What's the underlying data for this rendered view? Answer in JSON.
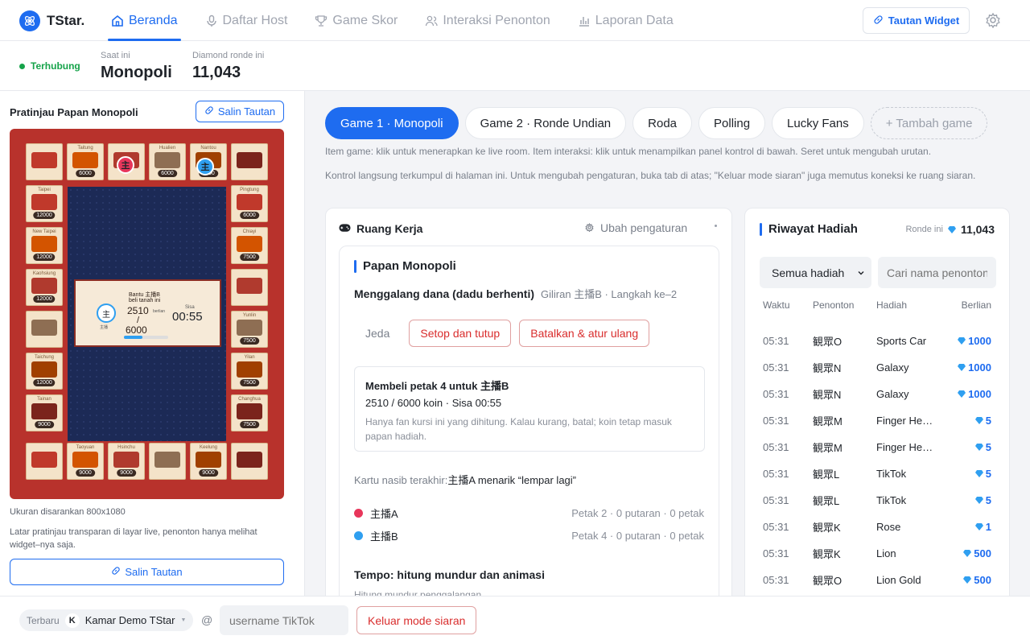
{
  "app": {
    "name": "TStar."
  },
  "nav": [
    {
      "label": "Beranda",
      "icon": "home-icon",
      "active": true
    },
    {
      "label": "Daftar Host",
      "icon": "microphone-icon",
      "active": false
    },
    {
      "label": "Game Skor",
      "icon": "trophy-icon",
      "active": false
    },
    {
      "label": "Interaksi Penonton",
      "icon": "users-icon",
      "active": false
    },
    {
      "label": "Laporan Data",
      "icon": "bar-chart-icon",
      "active": false
    }
  ],
  "header": {
    "widget_button": "Tautan Widget",
    "settings_icon": "gear-icon"
  },
  "status": {
    "connection": "Terhubung",
    "current_label": "Saat ini",
    "current_value": "Monopoli",
    "diamond_label": "Diamond ronde ini",
    "diamond_value": "11,043"
  },
  "preview": {
    "title": "Pratinjau Papan Monopoli",
    "copy_link": "Salin Tautan",
    "board": {
      "top_tiles": [
        {
          "name": "",
          "price": ""
        },
        {
          "name": "Taitung",
          "price": "6000"
        },
        {
          "name": "",
          "price": ""
        },
        {
          "name": "Hualien",
          "price": "6000"
        },
        {
          "name": "Nantou",
          "price": "6000"
        },
        {
          "name": "",
          "price": ""
        }
      ],
      "left_tiles": [
        {
          "name": "Taipei",
          "price": "12000"
        },
        {
          "name": "New Taipei",
          "price": "12000"
        },
        {
          "name": "Kaohsiung",
          "price": "12000"
        },
        {
          "name": "",
          "price": ""
        },
        {
          "name": "Taichung",
          "price": "12000"
        },
        {
          "name": "Tainan",
          "price": "9000"
        }
      ],
      "right_tiles": [
        {
          "name": "Pingtung",
          "price": "6000"
        },
        {
          "name": "Chiayi",
          "price": "7500"
        },
        {
          "name": "",
          "price": ""
        },
        {
          "name": "Yunlin",
          "price": "7500"
        },
        {
          "name": "Yilan",
          "price": "7500"
        },
        {
          "name": "Changhua",
          "price": "7500"
        }
      ],
      "bottom_tiles": [
        {
          "name": "",
          "price": ""
        },
        {
          "name": "Taoyuan",
          "price": "9000"
        },
        {
          "name": "Hsinchu",
          "price": "9000"
        },
        {
          "name": "",
          "price": ""
        },
        {
          "name": "Keelung",
          "price": "9000"
        },
        {
          "name": "",
          "price": ""
        }
      ],
      "tokens": [
        "主",
        "主"
      ],
      "card": {
        "line1": "Bantu 主播B",
        "line2": "beli tanah ini",
        "amount": "2510",
        "amount_unit": "berlian",
        "slash": "/",
        "target": "6000",
        "remaining_label": "Sisa",
        "timer": "00:55",
        "host_tag": "主播",
        "progress_fraction": 0.42
      }
    },
    "size_hint": "Ukuran disarankan 800x1080",
    "transparency_hint": "Latar pratinjau transparan di layar live, penonton hanya melihat widget–nya saja.",
    "copy_link_bottom": "Salin Tautan"
  },
  "games": {
    "tabs": [
      {
        "label": "Game 1 · Monopoli",
        "active": true
      },
      {
        "label": "Game 2 · Ronde Undian",
        "active": false
      },
      {
        "label": "Roda",
        "active": false
      },
      {
        "label": "Polling",
        "active": false
      },
      {
        "label": "Lucky Fans",
        "active": false
      }
    ],
    "add_label": "+ Tambah game",
    "note1": "Item game: klik untuk menerapkan ke live room. Item interaksi: klik untuk menampilkan panel kontrol di bawah. Seret untuk mengubah urutan.",
    "note2": "Kontrol langsung terkumpul di halaman ini. Untuk mengubah pengaturan, buka tab di atas; \"Keluar mode siaran\" juga memutus koneksi ke ruang siaran."
  },
  "workspace": {
    "title": "Ruang Kerja",
    "settings_link": "Ubah pengaturan",
    "board_title": "Papan Monopoli",
    "phase": "Menggalang dana (dadu berhenti)",
    "phase_meta": "Giliran 主播B · Langkah ke–2",
    "pause": "Jeda",
    "settle_button": "Setop dan tutup",
    "cancel_button": "Batalkan & atur ulang",
    "purchase": {
      "title": "Membeli petak 4 untuk 主播B",
      "progress": "2510 / 6000 koin · Sisa 00:55",
      "note": "Hanya fan kursi ini yang dihitung. Kalau kurang, batal; koin tetap masuk papan hadiah."
    },
    "last_card_label": "Kartu nasib terakhir:",
    "last_card_value": "主播A menarik “lempar lagi”",
    "players": [
      {
        "name": "主播A",
        "color": "#e8365b",
        "stats": "Petak 2 · 0 putaran · 0 petak"
      },
      {
        "name": "主播B",
        "color": "#2f9ff0",
        "stats": "Petak 4 · 0 putaran · 0 petak"
      }
    ],
    "tempo_title": "Tempo: hitung mundur dan animasi",
    "tempo_sub": "Hitung mundur penggalangan"
  },
  "gifts": {
    "title": "Riwayat Hadiah",
    "round_label": "Ronde ini",
    "round_value": "11,043",
    "filter_value": "Semua hadiah",
    "search_placeholder": "Cari nama penonton",
    "columns": [
      "Waktu",
      "Penonton",
      "Hadiah",
      "Berlian"
    ],
    "rows": [
      {
        "time": "05:31",
        "viewer": "観眾O",
        "gift": "Sports Car",
        "diamonds": "1000"
      },
      {
        "time": "05:31",
        "viewer": "観眾N",
        "gift": "Galaxy",
        "diamonds": "1000"
      },
      {
        "time": "05:31",
        "viewer": "観眾N",
        "gift": "Galaxy",
        "diamonds": "1000"
      },
      {
        "time": "05:31",
        "viewer": "観眾M",
        "gift": "Finger Heart",
        "diamonds": "5"
      },
      {
        "time": "05:31",
        "viewer": "観眾M",
        "gift": "Finger Heart",
        "diamonds": "5"
      },
      {
        "time": "05:31",
        "viewer": "観眾L",
        "gift": "TikTok",
        "diamonds": "5"
      },
      {
        "time": "05:31",
        "viewer": "観眾L",
        "gift": "TikTok",
        "diamonds": "5"
      },
      {
        "time": "05:31",
        "viewer": "観眾K",
        "gift": "Rose",
        "diamonds": "1"
      },
      {
        "time": "05:31",
        "viewer": "観眾K",
        "gift": "Lion",
        "diamonds": "500"
      },
      {
        "time": "05:31",
        "viewer": "観眾O",
        "gift": "Lion Gold",
        "diamonds": "500"
      }
    ]
  },
  "footer": {
    "recent_label": "Terbaru",
    "room_initial": "K",
    "room_name": "Kamar Demo TStar",
    "at": "@",
    "username_placeholder": "username TikTok",
    "exit_button": "Keluar mode siaran"
  },
  "colors": {
    "accent": "#1e6cf0",
    "danger": "#d92d2d",
    "success": "#16a34a",
    "board_red": "#b8322c"
  }
}
